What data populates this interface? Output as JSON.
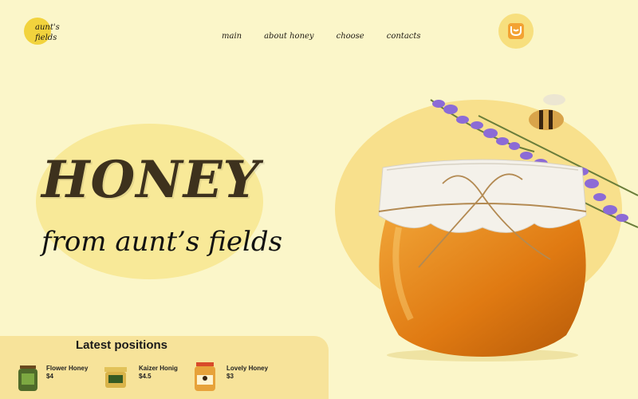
{
  "brand": {
    "name": "aunt's fields"
  },
  "nav": {
    "items": [
      "main",
      "about honey",
      "choose",
      "contacts"
    ]
  },
  "cart": {
    "icon": "shopping-bag-icon",
    "accent": "#f3a233"
  },
  "hero": {
    "title": "HONEY",
    "subtitle": "from aunt’s fields"
  },
  "latest": {
    "title": "Latest positions",
    "products": [
      {
        "name": "Flower Honey",
        "price": "$4"
      },
      {
        "name": "Kaizer Honig",
        "price": "$4.5"
      },
      {
        "name": "Lovely Honey",
        "price": "$3"
      }
    ]
  },
  "colors": {
    "background": "#fbf6c9",
    "blob": "#f8e998",
    "panel": "#f7e39a",
    "logo": "#f2d33d"
  }
}
